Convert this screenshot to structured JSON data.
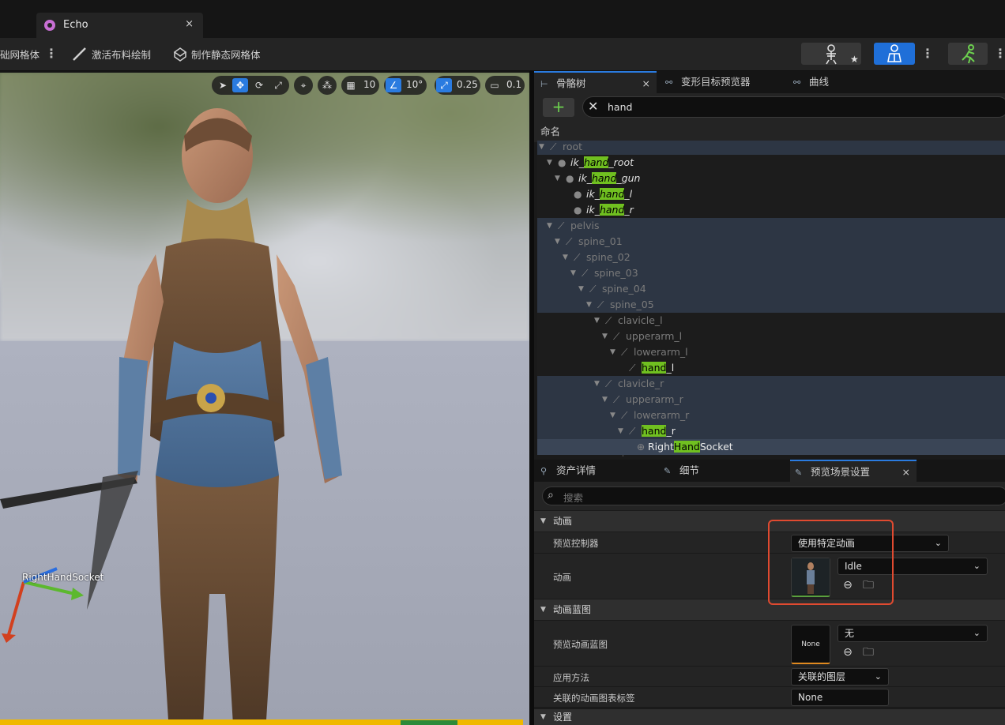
{
  "window": {
    "tab_title": "Echo",
    "tab_close": "×"
  },
  "toolbar": {
    "item1": "础网格体",
    "item2": "激活布料绘制",
    "item3": "制作静态网格体",
    "more": "⋮"
  },
  "viewport": {
    "grid_snap": "10",
    "rot_snap": "10°",
    "scale_snap": "0.25",
    "camera_speed": "0.1",
    "socket_label": "RightHandSocket"
  },
  "skeleton_panel": {
    "tabs": [
      {
        "label": "骨骼树",
        "close": "×"
      },
      {
        "label": "变形目标预览器"
      },
      {
        "label": "曲线"
      }
    ],
    "add_label": "+",
    "search_clear": "✕",
    "search_value": "hand",
    "column_header": "命名",
    "rows": [
      {
        "pre": "root",
        "hl": "",
        "post": ""
      },
      {
        "pre": "ik_",
        "hl": "hand",
        "post": "_root"
      },
      {
        "pre": "ik_",
        "hl": "hand",
        "post": "_gun"
      },
      {
        "pre": "ik_",
        "hl": "hand",
        "post": "_l"
      },
      {
        "pre": "ik_",
        "hl": "hand",
        "post": "_r"
      },
      {
        "pre": "pelvis",
        "hl": "",
        "post": ""
      },
      {
        "pre": "spine_01",
        "hl": "",
        "post": ""
      },
      {
        "pre": "spine_02",
        "hl": "",
        "post": ""
      },
      {
        "pre": "spine_03",
        "hl": "",
        "post": ""
      },
      {
        "pre": "spine_04",
        "hl": "",
        "post": ""
      },
      {
        "pre": "spine_05",
        "hl": "",
        "post": ""
      },
      {
        "pre": "clavicle_l",
        "hl": "",
        "post": ""
      },
      {
        "pre": "upperarm_l",
        "hl": "",
        "post": ""
      },
      {
        "pre": "lowerarm_l",
        "hl": "",
        "post": ""
      },
      {
        "pre": "",
        "hl": "hand",
        "post": "_l"
      },
      {
        "pre": "clavicle_r",
        "hl": "",
        "post": ""
      },
      {
        "pre": "upperarm_r",
        "hl": "",
        "post": ""
      },
      {
        "pre": "lowerarm_r",
        "hl": "",
        "post": ""
      },
      {
        "pre": "",
        "hl": "hand",
        "post": "_r"
      },
      {
        "pre": "Right",
        "hl": "Hand",
        "post": "Socket"
      }
    ]
  },
  "details_panel": {
    "tabs": [
      {
        "label": "资产详情"
      },
      {
        "label": "细节"
      },
      {
        "label": "预览场景设置",
        "close": "×"
      }
    ],
    "search_placeholder": "搜索",
    "cat_animation": "动画",
    "preview_controller_label": "预览控制器",
    "preview_controller_value": "使用特定动画",
    "animation_label": "动画",
    "animation_value": "Idle",
    "cat_anim_bp": "动画蓝图",
    "preview_anim_bp_label": "预览动画蓝图",
    "preview_anim_bp_thumb": "None",
    "preview_anim_bp_value": "无",
    "apply_method_label": "应用方法",
    "apply_method_value": "关联的图层",
    "linked_tag_label": "关联的动画图表标签",
    "linked_tag_value": "None",
    "cat_settings": "设置"
  }
}
